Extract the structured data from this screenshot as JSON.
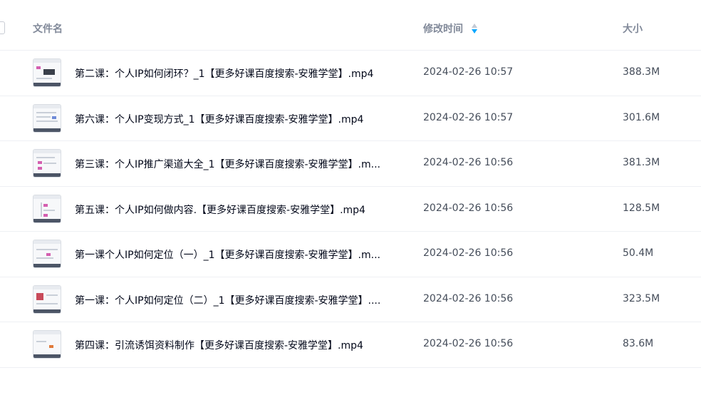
{
  "columns": {
    "name": "文件名",
    "modified": "修改时间",
    "size": "大小"
  },
  "sort": {
    "column": "modified",
    "direction": "desc",
    "active_color": "#06a7ff"
  },
  "files": [
    {
      "name": "第二课：个人IP如何闭环？_1【更多好课百度搜索-安雅学堂】.mp4",
      "modified": "2024-02-26 10:57",
      "size": "388.3M"
    },
    {
      "name": "第六课：个人IP变现方式_1【更多好课百度搜索-安雅学堂】.mp4",
      "modified": "2024-02-26 10:57",
      "size": "301.6M"
    },
    {
      "name": "第三课：个人IP推广渠道大全_1【更多好课百度搜索-安雅学堂】.m...",
      "modified": "2024-02-26 10:56",
      "size": "381.3M"
    },
    {
      "name": "第五课：个人IP如何做内容.【更多好课百度搜索-安雅学堂】.mp4",
      "modified": "2024-02-26 10:56",
      "size": "128.5M"
    },
    {
      "name": "第一课个人IP如何定位（一）_1【更多好课百度搜索-安雅学堂】.m...",
      "modified": "2024-02-26 10:56",
      "size": "50.4M"
    },
    {
      "name": "第一课：个人IP如何定位（二）_1【更多好课百度搜索-安雅学堂】....",
      "modified": "2024-02-26 10:56",
      "size": "323.5M"
    },
    {
      "name": "第四课：引流诱饵资料制作【更多好课百度搜索-安雅学堂】.mp4",
      "modified": "2024-02-26 10:56",
      "size": "83.6M"
    }
  ]
}
